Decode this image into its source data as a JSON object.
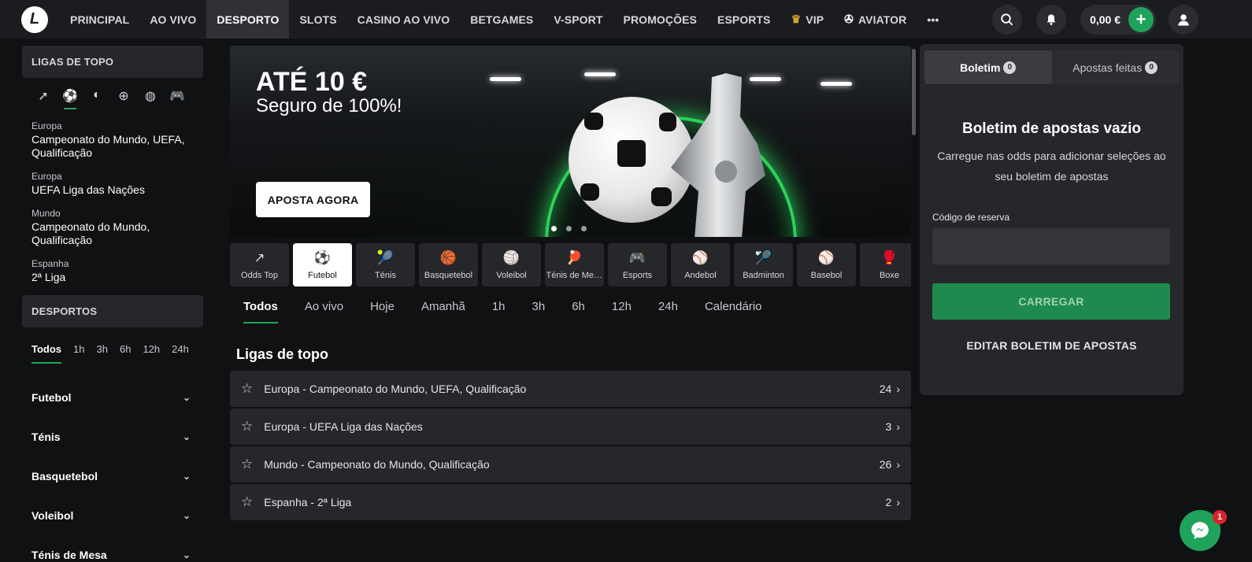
{
  "nav": {
    "logo": "L",
    "items": [
      {
        "label": "PRINCIPAL",
        "active": false
      },
      {
        "label": "AO VIVO",
        "active": false
      },
      {
        "label": "DESPORTO",
        "active": true
      },
      {
        "label": "SLOTS",
        "active": false
      },
      {
        "label": "CASINO AO VIVO",
        "active": false
      },
      {
        "label": "BETGAMES",
        "active": false
      },
      {
        "label": "V-SPORT",
        "active": false
      },
      {
        "label": "PROMOÇÕES",
        "active": false
      },
      {
        "label": "ESPORTS",
        "active": false
      },
      {
        "label": "VIP",
        "active": false,
        "icon": "crown-icon"
      },
      {
        "label": "AVIATOR",
        "active": false,
        "icon": "propeller-icon"
      }
    ],
    "more": "•••",
    "balance": "0,00 €",
    "plus": "+"
  },
  "sidebar": {
    "top_leagues_header": "LIGAS DE TOPO",
    "sport_icons": [
      "arrow-icon",
      "football-icon",
      "tennis-icon",
      "basketball-icon",
      "volleyball-icon",
      "gamepad-icon"
    ],
    "leagues": [
      {
        "category": "Europa",
        "name": "Campeonato do Mundo, UEFA, Qualificação"
      },
      {
        "category": "Europa",
        "name": "UEFA Liga das Nações"
      },
      {
        "category": "Mundo",
        "name": "Campeonato do Mundo, Qualificação"
      },
      {
        "category": "Espanha",
        "name": "2ª Liga"
      }
    ],
    "sports_header": "DESPORTOS",
    "time_filters": [
      "Todos",
      "1h",
      "3h",
      "6h",
      "12h",
      "24h"
    ],
    "sports": [
      "Futebol",
      "Ténis",
      "Basquetebol",
      "Voleibol",
      "Ténis de Mesa"
    ]
  },
  "banner": {
    "title": "ATÉ 10 €",
    "subtitle": "Seguro de 100%!",
    "cta": "APOSTA AGORA",
    "slides": 3,
    "active_slide": 0
  },
  "sport_tabs": [
    {
      "label": "Odds Top",
      "icon": "↗",
      "name": "odds-top-icon"
    },
    {
      "label": "Futebol",
      "icon": "⚽",
      "name": "football-icon",
      "active": true
    },
    {
      "label": "Ténis",
      "icon": "🎾",
      "name": "tennis-icon"
    },
    {
      "label": "Basquetebol",
      "icon": "🏀",
      "name": "basketball-icon"
    },
    {
      "label": "Voleibol",
      "icon": "🏐",
      "name": "volleyball-icon"
    },
    {
      "label": "Ténis de Mesa",
      "icon": "🏓",
      "name": "table-tennis-icon"
    },
    {
      "label": "Esports",
      "icon": "🎮",
      "name": "gamepad-icon"
    },
    {
      "label": "Andebol",
      "icon": "⚾",
      "name": "handball-icon"
    },
    {
      "label": "Badminton",
      "icon": "🏸",
      "name": "badminton-icon"
    },
    {
      "label": "Basebol",
      "icon": "⚾",
      "name": "baseball-icon"
    },
    {
      "label": "Boxe",
      "icon": "🥊",
      "name": "boxing-icon"
    }
  ],
  "time_tabs": [
    "Todos",
    "Ao vivo",
    "Hoje",
    "Amanhã",
    "1h",
    "3h",
    "6h",
    "12h",
    "24h",
    "Calendário"
  ],
  "section_title": "Ligas de topo",
  "league_rows": [
    {
      "name": "Europa - Campeonato do Mundo, UEFA, Qualificação",
      "count": "24"
    },
    {
      "name": "Europa - UEFA Liga das Nações",
      "count": "3"
    },
    {
      "name": "Mundo - Campeonato do Mundo, Qualificação",
      "count": "26"
    },
    {
      "name": "Espanha - 2ª Liga",
      "count": "2"
    }
  ],
  "betslip": {
    "tab_boletim": "Boletim",
    "tab_boletim_count": "0",
    "tab_apostas": "Apostas feitas",
    "tab_apostas_count": "0",
    "empty_title": "Boletim de apostas vazio",
    "empty_desc": "Carregue nas odds para adicionar seleções ao seu boletim de apostas",
    "code_label": "Código de reserva",
    "code_value": "",
    "load_button": "CARREGAR",
    "edit_button": "EDITAR BOLETIM DE APOSTAS"
  },
  "chat": {
    "badge": "1"
  },
  "colors": {
    "accent": "#1fa35a",
    "panel": "#25272b",
    "bg": "#101113",
    "nav": "#1b1c1f"
  }
}
